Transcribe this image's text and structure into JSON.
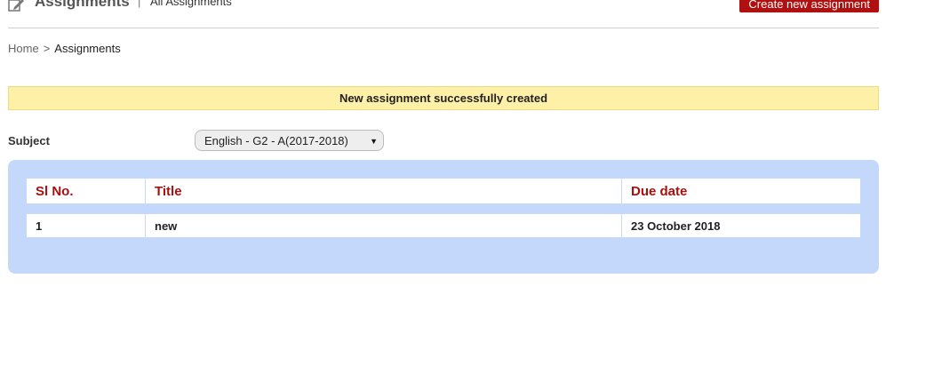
{
  "header": {
    "title": "Assignments",
    "separator": "|",
    "subtitle": "All Assignments",
    "create_button": "Create new assignment"
  },
  "breadcrumb": {
    "home": "Home",
    "arrow": ">",
    "current": "Assignments"
  },
  "alert": {
    "message": "New assignment successfully created"
  },
  "filter": {
    "label": "Subject",
    "selected": "English - G2 - A(2017-2018)"
  },
  "table": {
    "headers": [
      "Sl No.",
      "Title",
      "Due date"
    ],
    "rows": [
      [
        "1",
        "new",
        "23 October 2018"
      ]
    ]
  },
  "colors": {
    "brand_red": "#b01010",
    "header_text_red": "#a81010",
    "panel_blue": "#c3d8fb",
    "alert_yellow": "#fff0a8"
  },
  "icons": {
    "header": "edit-icon",
    "select_caret": "caret-down-icon"
  }
}
